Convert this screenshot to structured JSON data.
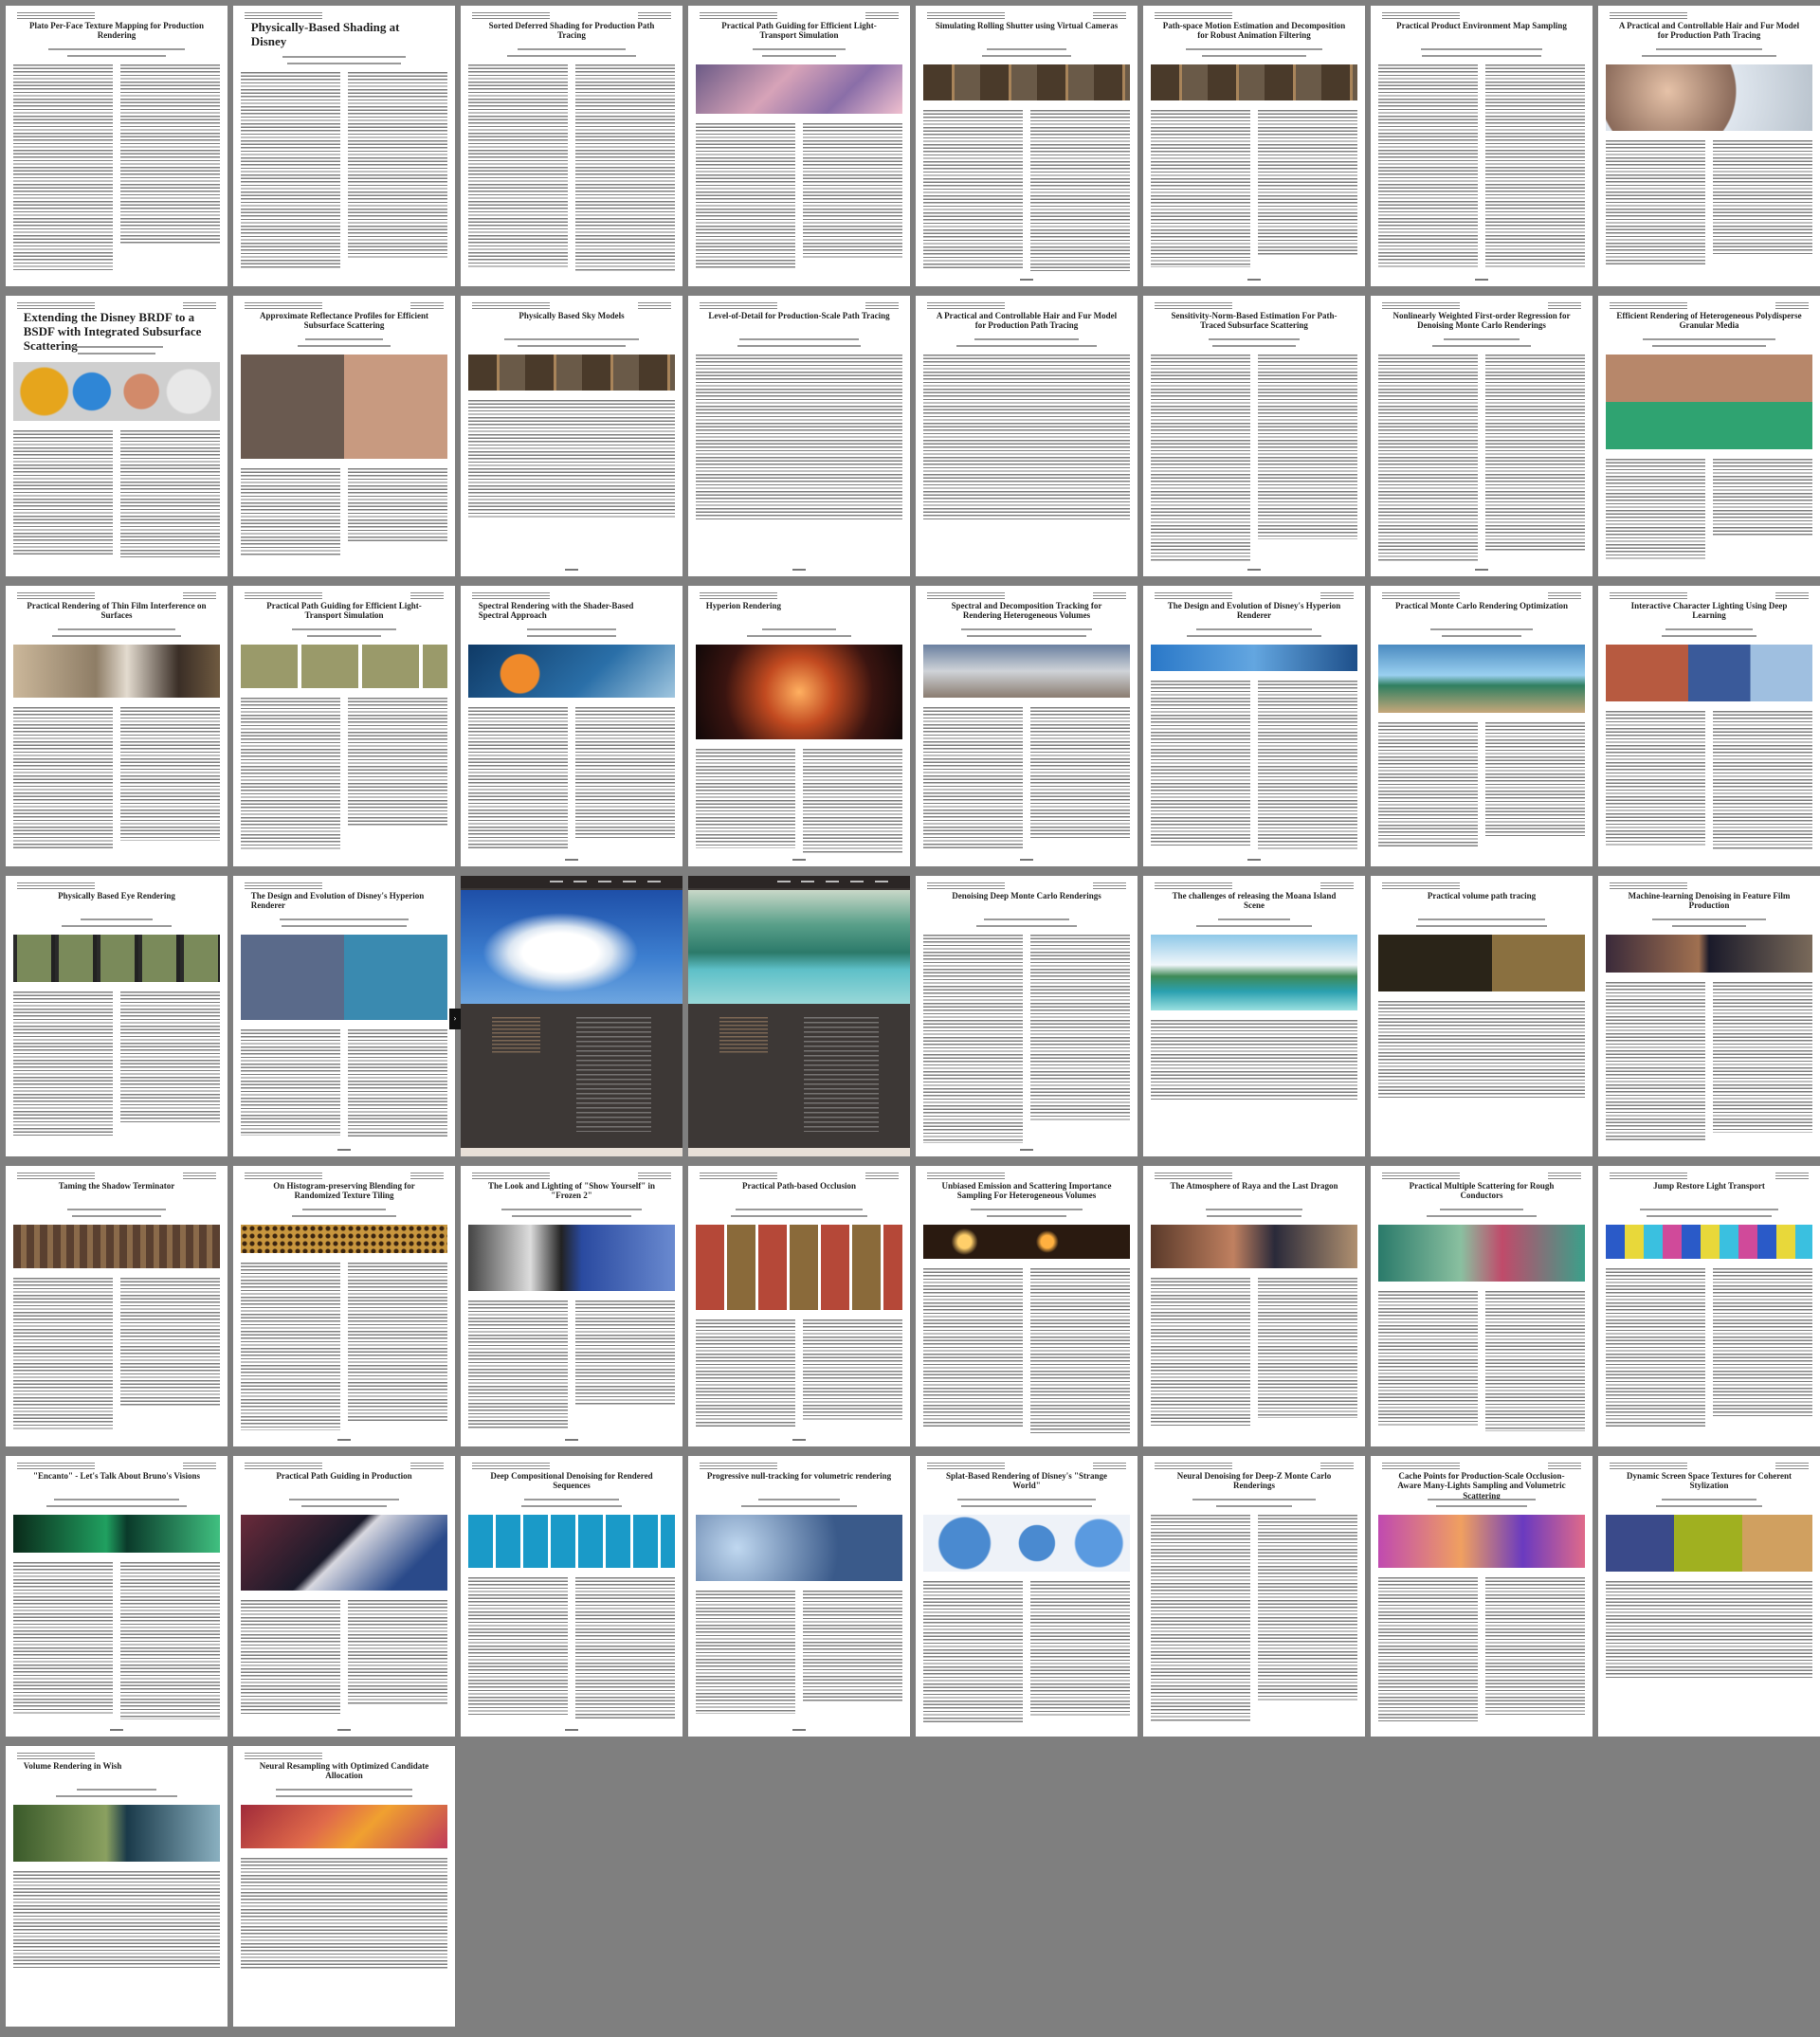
{
  "viewer": {
    "background": "#7f7f7f",
    "layout": "thumbnail-grid",
    "columns": 8,
    "rows": 7,
    "page_count": 50
  },
  "pages": [
    {
      "title": "Plato Per-Face Texture Mapping for Production Rendering",
      "figure": null
    },
    {
      "title": "Physically-Based Shading at Disney",
      "figure": null,
      "left": true,
      "big": true
    },
    {
      "title": "Sorted Deferred Shading for Production Path Tracing",
      "figure": null
    },
    {
      "title": "Practical Path Guiding for Efficient Light-Transport Simulation",
      "figure": "clouds"
    },
    {
      "title": "Simulating Rolling Shutter using Virtual Cameras",
      "figure": "strip"
    },
    {
      "title": "Path-space Motion Estimation and Decomposition for Robust Animation Filtering",
      "figure": "strip"
    },
    {
      "title": "Practical Product Environment Map Sampling",
      "figure": null
    },
    {
      "title": "A Practical and Controllable Hair and Fur Model for Production Path Tracing",
      "figure": "character"
    },
    {
      "title": "Extending the Disney BRDF to a BSDF with Integrated Subsurface Scattering",
      "figure": "spheres",
      "left": true,
      "big": true
    },
    {
      "title": "Approximate Reflectance Profiles for Efficient Subsurface Scattering",
      "figure": "faces"
    },
    {
      "title": "Physically Based Sky Models",
      "figure": "strip"
    },
    {
      "title": "Level-of-Detail for Production-Scale Path Tracing",
      "figure": null
    },
    {
      "title": "A Practical and Controllable Hair and Fur Model for Production Path Tracing",
      "figure": null
    },
    {
      "title": "Sensitivity-Norm-Based Estimation For Path-Traced Subsurface Scattering",
      "figure": null
    },
    {
      "title": "Nonlinearly Weighted First-order Regression for Denoising Monte Carlo Renderings",
      "figure": null
    },
    {
      "title": "Efficient Rendering of Heterogeneous Polydisperse Granular Media",
      "figure": "dragons"
    },
    {
      "title": "Practical Rendering of Thin Film Interference on Surfaces",
      "figure": "bowl"
    },
    {
      "title": "Practical Path Guiding for Efficient Light-Transport Simulation",
      "figure": "three"
    },
    {
      "title": "Spectral Rendering with the Shader-Based Spectral Approach",
      "figure": "fish",
      "left": true
    },
    {
      "title": "Hyperion Rendering",
      "figure": "fire",
      "left": true
    },
    {
      "title": "Spectral and Decomposition Tracking for Rendering Heterogeneous Volumes",
      "figure": "sky"
    },
    {
      "title": "The Design and Evolution of Disney's Hyperion Renderer",
      "figure": "blue"
    },
    {
      "title": "Practical Monte Carlo Rendering Optimization",
      "figure": "island"
    },
    {
      "title": "Interactive Character Lighting Using Deep Learning",
      "figure": "snow"
    },
    {
      "title": "Physically Based Eye Rendering",
      "figure": "eyes"
    },
    {
      "title": "The Design and Evolution of Disney's Hyperion Renderer",
      "figure": "collage",
      "left": true
    },
    {
      "title": "",
      "figure": "cloudweb",
      "dark": true
    },
    {
      "title": "",
      "figure": "tropicweb",
      "dark": true
    },
    {
      "title": "Denoising Deep Monte Carlo Renderings",
      "figure": null
    },
    {
      "title": "The challenges of releasing the Moana Island Scene",
      "figure": "island2"
    },
    {
      "title": "Practical volume path tracing",
      "figure": "dark"
    },
    {
      "title": "Machine-learning Denoising in Feature Film Production",
      "figure": "film"
    },
    {
      "title": "Taming the Shadow Terminator",
      "figure": "curtain"
    },
    {
      "title": "On Histogram-preserving Blending for Randomized Texture Tiling",
      "figure": "leopard"
    },
    {
      "title": "The Look and Lighting of \"Show Yourself\" in \"Frozen 2\"",
      "figure": "bw"
    },
    {
      "title": "Practical Path-based Occlusion",
      "figure": "rooms"
    },
    {
      "title": "Unbiased Emission and Scattering Importance Sampling For Heterogeneous Volumes",
      "figure": "sparks"
    },
    {
      "title": "The Atmosphere of Raya and the Last Dragon",
      "figure": "raya"
    },
    {
      "title": "Practical Multiple Scattering for Rough Conductors",
      "figure": "green"
    },
    {
      "title": "Jump Restore Light Transport",
      "figure": "colorful"
    },
    {
      "title": "\"Encanto\" - Let's Talk About Bruno's Visions",
      "figure": "encanto"
    },
    {
      "title": "Practical Path Guiding in Production",
      "figure": "house"
    },
    {
      "title": "Deep Compositional Denoising for Rendered Sequences",
      "figure": "tiles"
    },
    {
      "title": "Progressive null-tracking for volumetric rendering",
      "figure": "clouds2"
    },
    {
      "title": "Splat-Based Rendering of Disney's \"Strange World\"",
      "figure": "creatures"
    },
    {
      "title": "Neural Denoising for Deep-Z Monte Carlo Renderings",
      "figure": null
    },
    {
      "title": "Cache Points for Production-Scale Occlusion-Aware Many-Lights Sampling and Volumetric Scattering",
      "figure": "carnival"
    },
    {
      "title": "Dynamic Screen Space Textures for Coherent Stylization",
      "figure": "stylized"
    },
    {
      "title": "Volume Rendering in Wish",
      "figure": "forest",
      "left": true
    },
    {
      "title": "Neural Resampling with Optimized Candidate Allocation",
      "figure": "coral"
    }
  ]
}
